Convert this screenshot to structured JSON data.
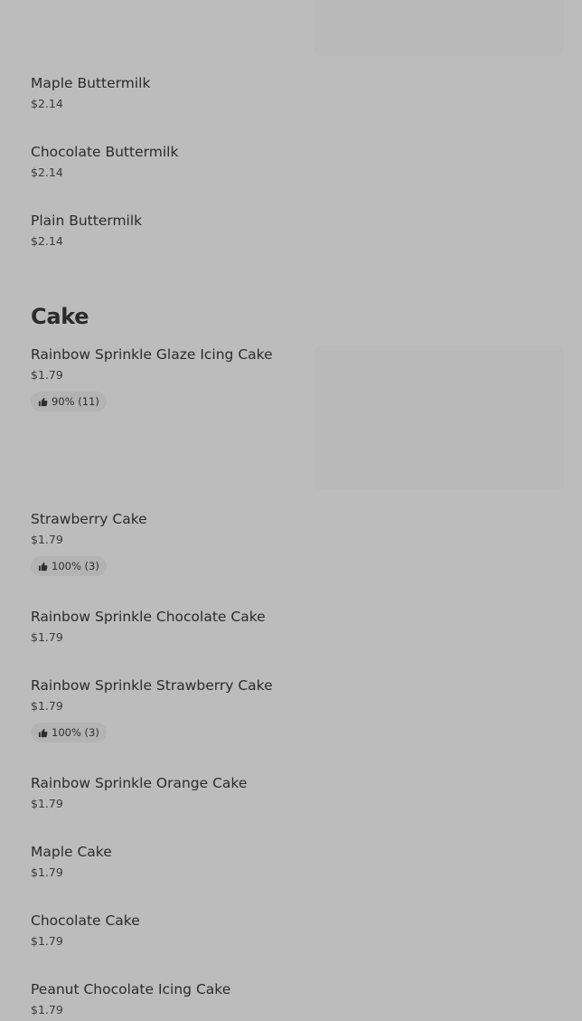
{
  "top_items": [
    {
      "name": "Maple Buttermilk",
      "price": "$2.14"
    },
    {
      "name": "Chocolate Buttermilk",
      "price": "$2.14"
    },
    {
      "name": "Plain Buttermilk",
      "price": "$2.14"
    }
  ],
  "cake_section": {
    "title": "Cake",
    "items": [
      {
        "name": "Rainbow Sprinkle Glaze Icing Cake",
        "price": "$1.79",
        "rating": "90% (11)"
      },
      {
        "name": "Strawberry Cake",
        "price": "$1.79",
        "rating": "100% (3)"
      },
      {
        "name": "Rainbow Sprinkle Chocolate Cake",
        "price": "$1.79"
      },
      {
        "name": "Rainbow Sprinkle Strawberry Cake",
        "price": "$1.79",
        "rating": "100% (3)"
      },
      {
        "name": "Rainbow Sprinkle Orange Cake",
        "price": "$1.79"
      },
      {
        "name": "Maple Cake",
        "price": "$1.79"
      },
      {
        "name": "Chocolate Cake",
        "price": "$1.79"
      },
      {
        "name": "Peanut Chocolate Icing Cake",
        "price": "$1.79"
      }
    ]
  },
  "icons": {
    "rating_icon": "thumbs-up-icon"
  },
  "colors": {
    "overlay_background": "#bcbcbc",
    "image_placeholder": "#b9b9b9",
    "rating_badge_background": "#b3b3b3",
    "text": "#2b2b2b"
  }
}
